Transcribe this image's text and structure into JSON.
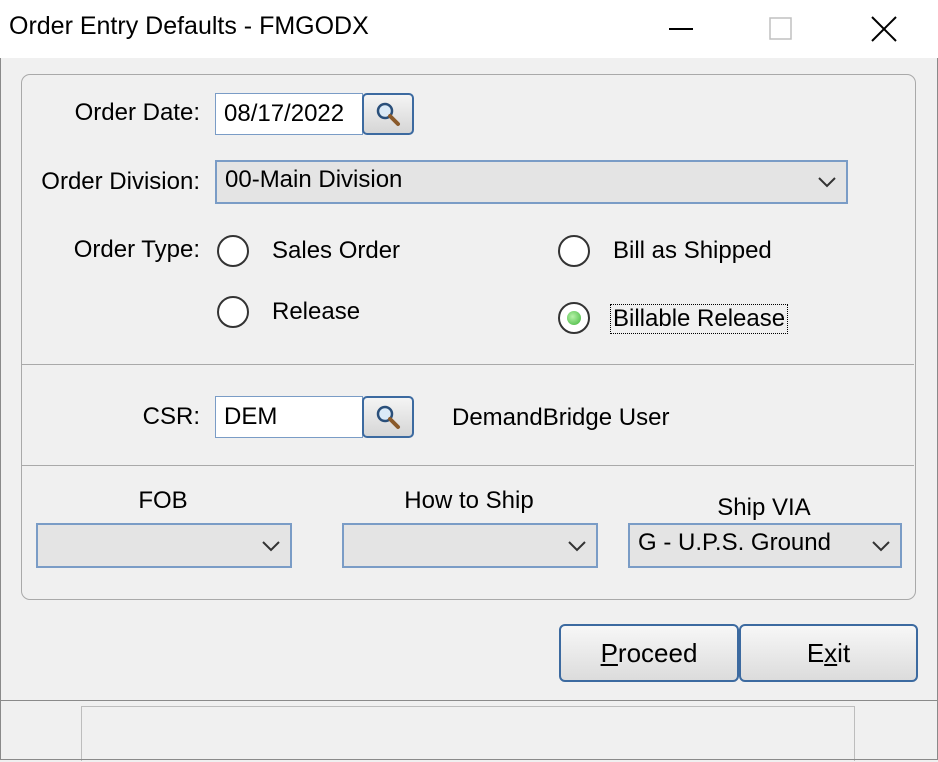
{
  "window": {
    "title": "Order Entry Defaults - FMGODX",
    "icons": [
      "minimize-icon",
      "maximize-icon",
      "close-icon"
    ]
  },
  "order_date": {
    "label": "Order Date:",
    "value": "08/17/2022",
    "lookup_icon": "magnifier-icon"
  },
  "order_division": {
    "label": "Order Division:",
    "value": "00-Main Division"
  },
  "order_type": {
    "label": "Order Type:",
    "options": [
      {
        "label": "Sales Order",
        "checked": false
      },
      {
        "label": "Bill as Shipped",
        "checked": false
      },
      {
        "label": "Release",
        "checked": false
      },
      {
        "label": "Billable Release",
        "checked": true
      }
    ]
  },
  "csr": {
    "label": "CSR:",
    "value": "DEM",
    "name": "DemandBridge User",
    "lookup_icon": "magnifier-icon"
  },
  "shipping": {
    "fob": {
      "label": "FOB",
      "value": ""
    },
    "how_to_ship": {
      "label": "How to Ship",
      "value": ""
    },
    "ship_via": {
      "label": "Ship VIA",
      "value": "G - U.P.S. Ground"
    }
  },
  "buttons": {
    "proceed_pre": "",
    "proceed_mnemonic": "P",
    "proceed_post": "roceed",
    "exit_pre": "E",
    "exit_mnemonic": "x",
    "exit_post": "it"
  },
  "colors": {
    "border_accent": "#3c6aa0",
    "radio_selected": "#3fb53a"
  }
}
